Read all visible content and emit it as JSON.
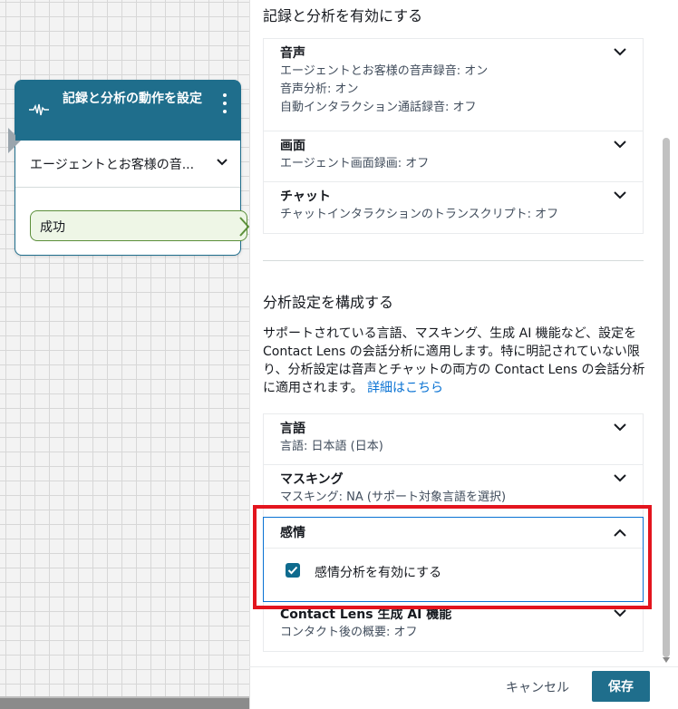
{
  "block": {
    "title": "記録と分析の動作を設定",
    "select_value": "エージェントとお客様の音...",
    "branch_label": "成功"
  },
  "panel": {
    "record_section_title": "記録と分析を有効にする",
    "record_items": [
      {
        "title": "音声",
        "lines": [
          "エージェントとお客様の音声録音: オン",
          "音声分析: オン",
          "自動インタラクション通話録音: オフ"
        ]
      },
      {
        "title": "画面",
        "lines": [
          "エージェント画面録画: オフ"
        ]
      },
      {
        "title": "チャット",
        "lines": [
          "チャットインタラクションのトランスクリプト: オフ"
        ]
      }
    ],
    "analysis_section_title": "分析設定を構成する",
    "description": "サポートされている言語、マスキング、生成 AI 機能など、設定を Contact Lens の会話分析に適用します。特に明記されていない限り、分析設定は音声とチャットの両方の Contact Lens の会話分析に適用されます。",
    "learn_more": "詳細はこちら",
    "analysis_items": [
      {
        "title": "言語",
        "lines": [
          "言語: 日本語 (日本)"
        ]
      },
      {
        "title": "マスキング",
        "lines": [
          "マスキング: NA (サポート対象言語を選択)"
        ]
      }
    ],
    "sentiment": {
      "title": "感情",
      "checkbox_label": "感情分析を有効にする",
      "checked": true
    },
    "genai": {
      "title": "Contact Lens 生成 AI 機能",
      "lines": [
        "コンタクト後の概要: オフ"
      ]
    },
    "cancel_label": "キャンセル",
    "save_label": "保存"
  },
  "colors": {
    "primary": "#1f6e8c",
    "link": "#0972d3",
    "highlight": "#e3151e",
    "branch_border": "#5c8f3a"
  }
}
